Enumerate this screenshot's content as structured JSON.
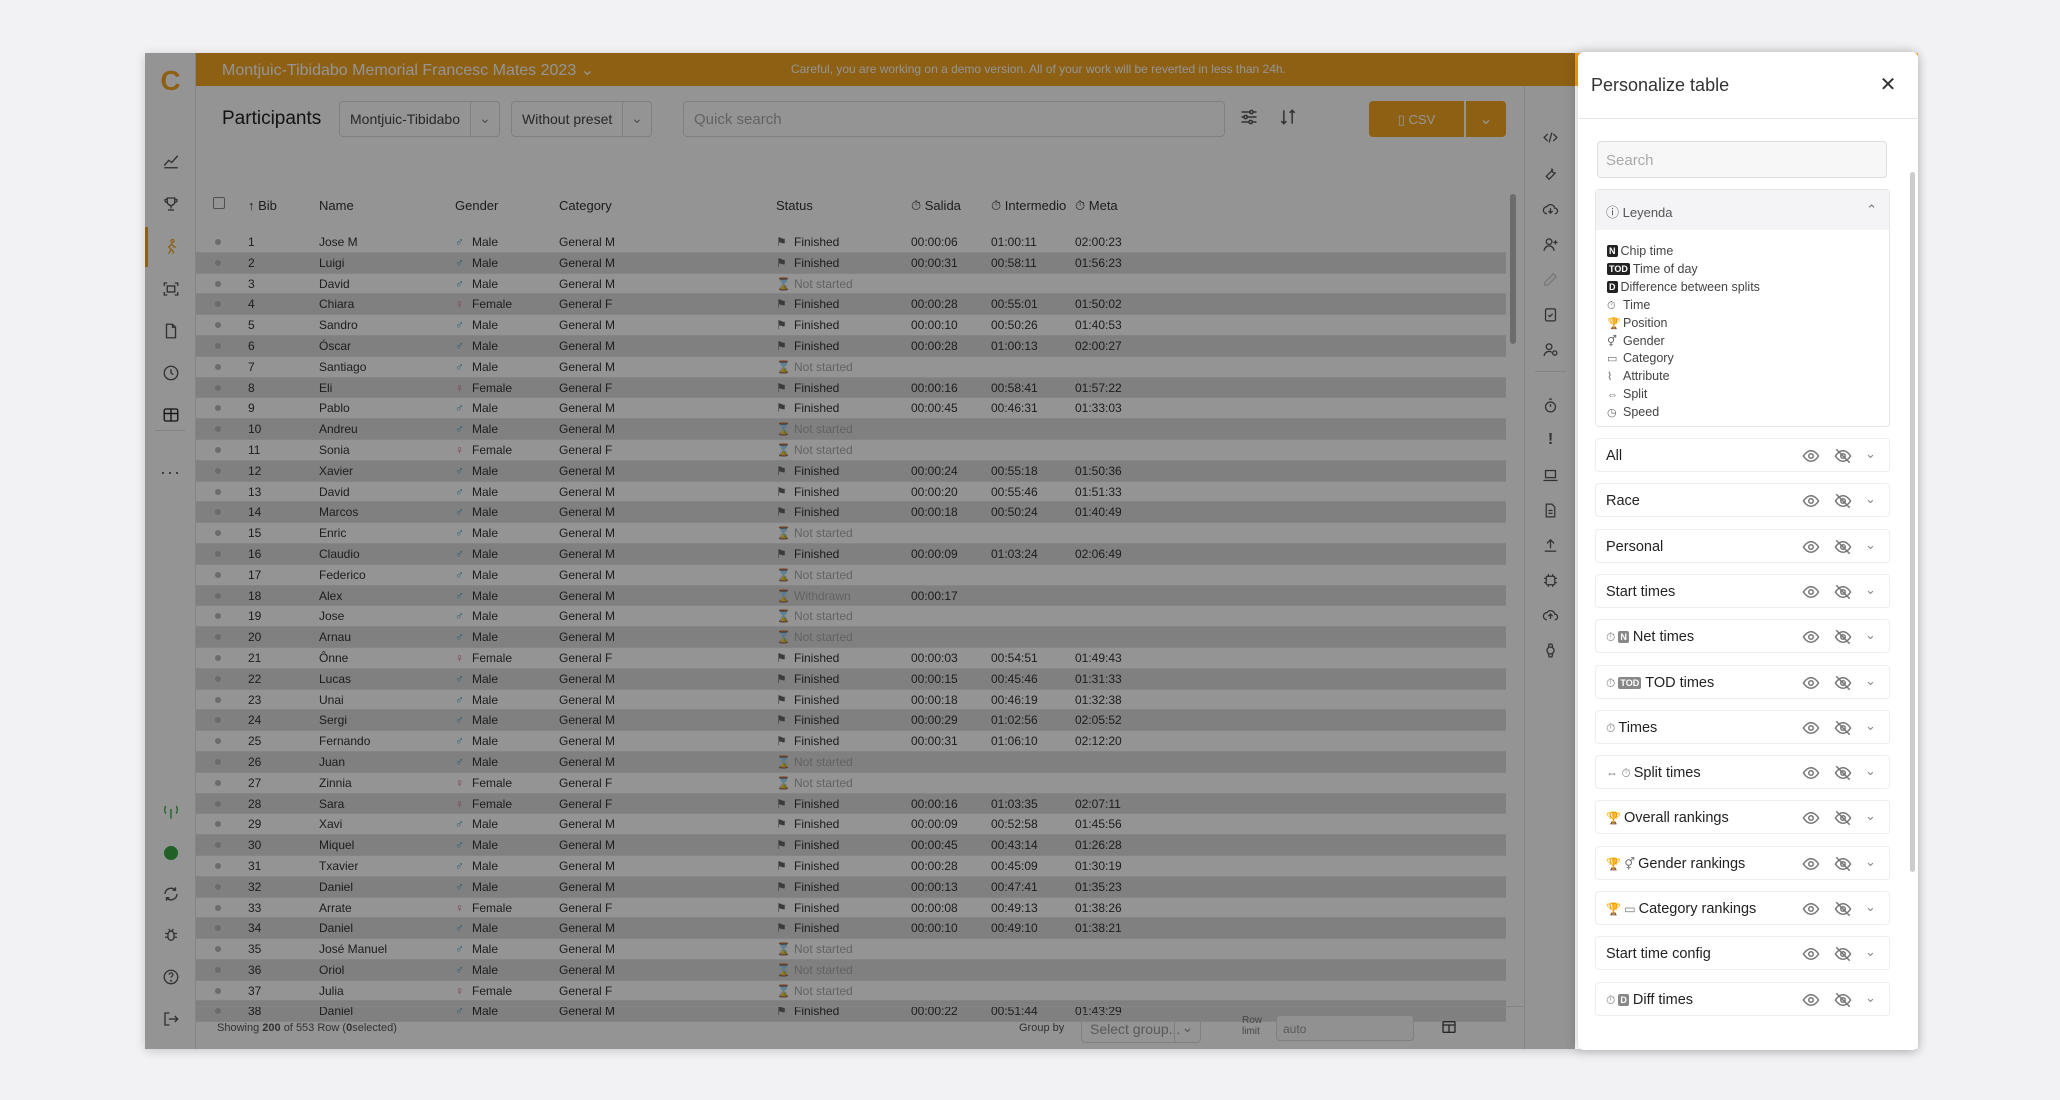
{
  "banner": {
    "event": "Montjuic-Tibidabo Memorial Francesc Mates 2023",
    "warning": "Careful, you are working on a demo version. All of your work will be reverted in less than 24h."
  },
  "logo": "C",
  "toolbar": {
    "title": "Participants",
    "race_select": "Montjuic-Tibidabo",
    "preset_select": "Without preset",
    "search_placeholder": "Quick search",
    "csv_label": "CSV"
  },
  "table": {
    "headers": {
      "bib": "Bib",
      "name": "Name",
      "gender": "Gender",
      "category": "Category",
      "status": "Status",
      "salida": "Salida",
      "intermedio": "Intermedio",
      "meta": "Meta"
    },
    "rows": [
      [
        "1",
        "Jose M",
        "Male",
        "General M",
        "Finished",
        "00:00:06",
        "01:00:11",
        "02:00:23"
      ],
      [
        "2",
        "Luigi",
        "Male",
        "General M",
        "Finished",
        "00:00:31",
        "00:58:11",
        "01:56:23"
      ],
      [
        "3",
        "David",
        "Male",
        "General M",
        "Not started",
        "",
        "",
        ""
      ],
      [
        "4",
        "Chiara",
        "Female",
        "General F",
        "Finished",
        "00:00:28",
        "00:55:01",
        "01:50:02"
      ],
      [
        "5",
        "Sandro",
        "Male",
        "General M",
        "Finished",
        "00:00:10",
        "00:50:26",
        "01:40:53"
      ],
      [
        "6",
        "Óscar",
        "Male",
        "General M",
        "Finished",
        "00:00:28",
        "01:00:13",
        "02:00:27"
      ],
      [
        "7",
        "Santiago",
        "Male",
        "General M",
        "Not started",
        "",
        "",
        ""
      ],
      [
        "8",
        "Eli",
        "Female",
        "General F",
        "Finished",
        "00:00:16",
        "00:58:41",
        "01:57:22"
      ],
      [
        "9",
        "Pablo",
        "Male",
        "General M",
        "Finished",
        "00:00:45",
        "00:46:31",
        "01:33:03"
      ],
      [
        "10",
        "Andreu",
        "Male",
        "General M",
        "Not started",
        "",
        "",
        ""
      ],
      [
        "11",
        "Sonia",
        "Female",
        "General F",
        "Not started",
        "",
        "",
        ""
      ],
      [
        "12",
        "Xavier",
        "Male",
        "General M",
        "Finished",
        "00:00:24",
        "00:55:18",
        "01:50:36"
      ],
      [
        "13",
        "David",
        "Male",
        "General M",
        "Finished",
        "00:00:20",
        "00:55:46",
        "01:51:33"
      ],
      [
        "14",
        "Marcos",
        "Male",
        "General M",
        "Finished",
        "00:00:18",
        "00:50:24",
        "01:40:49"
      ],
      [
        "15",
        "Enric",
        "Male",
        "General M",
        "Not started",
        "",
        "",
        ""
      ],
      [
        "16",
        "Claudio",
        "Male",
        "General M",
        "Finished",
        "00:00:09",
        "01:03:24",
        "02:06:49"
      ],
      [
        "17",
        "Federico",
        "Male",
        "General M",
        "Not started",
        "",
        "",
        ""
      ],
      [
        "18",
        "Alex",
        "Male",
        "General M",
        "Withdrawn",
        "00:00:17",
        "",
        ""
      ],
      [
        "19",
        "Jose",
        "Male",
        "General M",
        "Not started",
        "",
        "",
        ""
      ],
      [
        "20",
        "Arnau",
        "Male",
        "General M",
        "Not started",
        "",
        "",
        ""
      ],
      [
        "21",
        "Ônne",
        "Female",
        "General F",
        "Finished",
        "00:00:03",
        "00:54:51",
        "01:49:43"
      ],
      [
        "22",
        "Lucas",
        "Male",
        "General M",
        "Finished",
        "00:00:15",
        "00:45:46",
        "01:31:33"
      ],
      [
        "23",
        "Unai",
        "Male",
        "General M",
        "Finished",
        "00:00:18",
        "00:46:19",
        "01:32:38"
      ],
      [
        "24",
        "Sergi",
        "Male",
        "General M",
        "Finished",
        "00:00:29",
        "01:02:56",
        "02:05:52"
      ],
      [
        "25",
        "Fernando",
        "Male",
        "General M",
        "Finished",
        "00:00:31",
        "01:06:10",
        "02:12:20"
      ],
      [
        "26",
        "Juan",
        "Male",
        "General M",
        "Not started",
        "",
        "",
        ""
      ],
      [
        "27",
        "Zinnia",
        "Female",
        "General F",
        "Not started",
        "",
        "",
        ""
      ],
      [
        "28",
        "Sara",
        "Female",
        "General F",
        "Finished",
        "00:00:16",
        "01:03:35",
        "02:07:11"
      ],
      [
        "29",
        "Xavi",
        "Male",
        "General M",
        "Finished",
        "00:00:09",
        "00:52:58",
        "01:45:56"
      ],
      [
        "30",
        "Miquel",
        "Male",
        "General M",
        "Finished",
        "00:00:45",
        "00:43:14",
        "01:26:28"
      ],
      [
        "31",
        "Txavier",
        "Male",
        "General M",
        "Finished",
        "00:00:28",
        "00:45:09",
        "01:30:19"
      ],
      [
        "32",
        "Daniel",
        "Male",
        "General M",
        "Finished",
        "00:00:13",
        "00:47:41",
        "01:35:23"
      ],
      [
        "33",
        "Arrate",
        "Female",
        "General F",
        "Finished",
        "00:00:08",
        "00:49:13",
        "01:38:26"
      ],
      [
        "34",
        "Daniel",
        "Male",
        "General M",
        "Finished",
        "00:00:10",
        "00:49:10",
        "01:38:21"
      ],
      [
        "35",
        "José Manuel",
        "Male",
        "General M",
        "Not started",
        "",
        "",
        ""
      ],
      [
        "36",
        "Oriol",
        "Male",
        "General M",
        "Not started",
        "",
        "",
        ""
      ],
      [
        "37",
        "Julia",
        "Female",
        "General F",
        "Not started",
        "",
        "",
        ""
      ],
      [
        "38",
        "Daniel",
        "Male",
        "General M",
        "Finished",
        "00:00:22",
        "00:51:44",
        "01:43:29"
      ]
    ]
  },
  "footer": {
    "showing_prefix": "Showing",
    "shown": "200",
    "of": "of",
    "total": "553",
    "row_label": "Row (",
    "selected": "0",
    "selected_suffix": "selected)",
    "group_by_label": "Group by",
    "group_placeholder": "Select group...",
    "row_limit_label_1": "Row",
    "row_limit_label_2": "limit",
    "row_limit_value": "auto"
  },
  "panel": {
    "title": "Personalize table",
    "search_placeholder": "Search",
    "legend_title": "Leyenda",
    "legend": [
      {
        "badge": "N",
        "text": "Chip time"
      },
      {
        "badge": "TOD",
        "text": "Time of day"
      },
      {
        "badge": "D",
        "text": "Difference between splits"
      },
      {
        "icon": "stopwatch-icon",
        "glyph": "⏱",
        "text": "Time"
      },
      {
        "icon": "trophy-icon",
        "glyph": "🏆",
        "text": "Position"
      },
      {
        "icon": "gender-icon",
        "glyph": "⚥",
        "text": "Gender"
      },
      {
        "icon": "calendar-icon",
        "glyph": "▭",
        "text": "Category"
      },
      {
        "icon": "paperclip-icon",
        "glyph": "⌇",
        "text": "Attribute"
      },
      {
        "icon": "link-icon",
        "glyph": "⇔",
        "text": "Split"
      },
      {
        "icon": "speed-icon",
        "glyph": "◷",
        "text": "Speed"
      }
    ],
    "groups": [
      {
        "label": "All",
        "prefix": ""
      },
      {
        "label": "Race",
        "prefix": ""
      },
      {
        "label": "Personal",
        "prefix": ""
      },
      {
        "label": "Start times",
        "prefix": ""
      },
      {
        "label": "Net times",
        "prefix": "⏱",
        "badge": "N"
      },
      {
        "label": "TOD times",
        "prefix": "⏱",
        "badge": "TOD"
      },
      {
        "label": "Times",
        "prefix": "⏱"
      },
      {
        "label": "Split times",
        "prefix": "⇔ ⏱"
      },
      {
        "label": "Overall rankings",
        "prefix": "🏆"
      },
      {
        "label": "Gender rankings",
        "prefix": "🏆 ⚥"
      },
      {
        "label": "Category rankings",
        "prefix": "🏆 ▭"
      },
      {
        "label": "Start time config",
        "prefix": ""
      },
      {
        "label": "Diff times",
        "prefix": "⏱",
        "badge": "D"
      }
    ]
  },
  "colors": {
    "accent": "#f5a623",
    "male": "#4aa3c8",
    "female": "#e36f8c"
  }
}
